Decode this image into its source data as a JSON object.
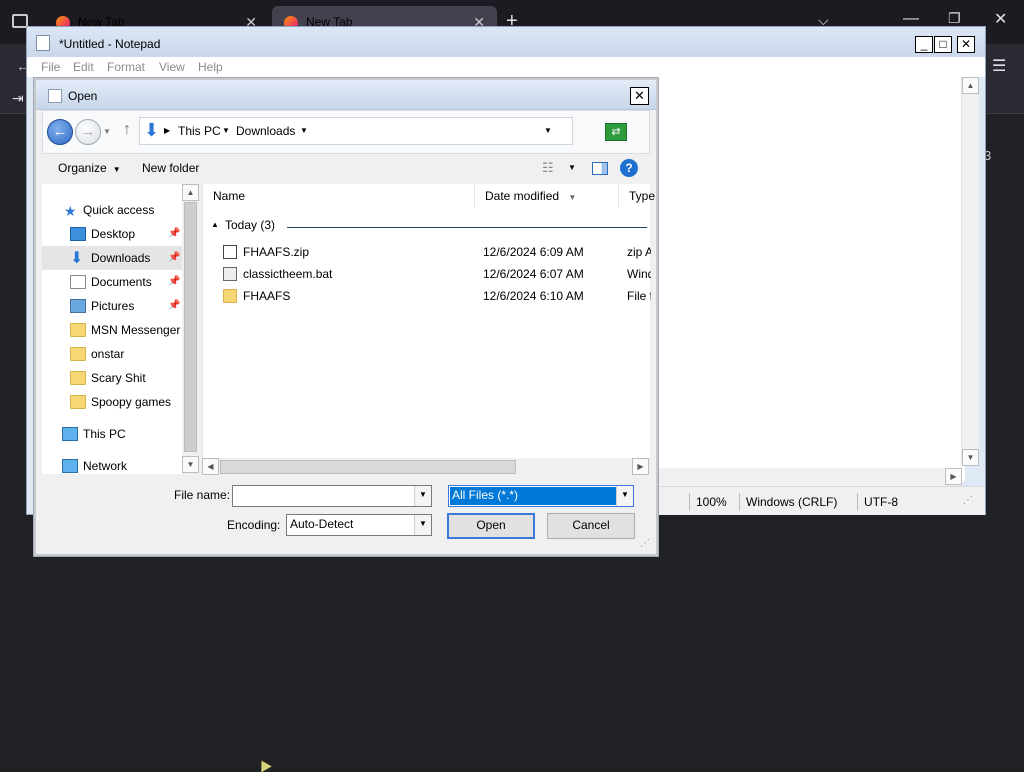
{
  "browser": {
    "tabs": [
      {
        "label": "New Tab"
      },
      {
        "label": "New Tab"
      }
    ],
    "right_partial_text": "3"
  },
  "notepad": {
    "title": "*Untitled - Notepad",
    "menu": [
      "File",
      "Edit",
      "Format",
      "View",
      "Help"
    ],
    "status": {
      "zoom": "100%",
      "line_ending": "Windows (CRLF)",
      "encoding": "UTF-8"
    }
  },
  "dialog": {
    "title": "Open",
    "breadcrumb": [
      "This PC",
      "Downloads"
    ],
    "commands": {
      "organize": "Organize",
      "new_folder": "New folder"
    },
    "nav_items": [
      {
        "label": "Quick access",
        "icon": "star-icon"
      },
      {
        "label": "Desktop",
        "icon": "desktop-icon",
        "pinned": true
      },
      {
        "label": "Downloads",
        "icon": "downloads-icon",
        "pinned": true,
        "selected": true
      },
      {
        "label": "Documents",
        "icon": "documents-icon",
        "pinned": true
      },
      {
        "label": "Pictures",
        "icon": "pictures-icon",
        "pinned": true
      },
      {
        "label": "MSN Messenger",
        "icon": "folder-icon"
      },
      {
        "label": "onstar",
        "icon": "folder-icon"
      },
      {
        "label": "Scary Shit",
        "icon": "folder-icon"
      },
      {
        "label": "Spoopy games",
        "icon": "folder-icon"
      },
      {
        "label": "This PC",
        "icon": "computer-icon"
      },
      {
        "label": "Network",
        "icon": "network-icon"
      }
    ],
    "columns": {
      "name": "Name",
      "date": "Date modified",
      "type": "Type"
    },
    "group_label": "Today (3)",
    "files": [
      {
        "name": "FHAAFS.zip",
        "date": "12/6/2024 6:09 AM",
        "type": "zip A",
        "icon": "zip-icon"
      },
      {
        "name": "classictheem.bat",
        "date": "12/6/2024 6:07 AM",
        "type": "Wind",
        "icon": "batch-file-icon"
      },
      {
        "name": "FHAAFS",
        "date": "12/6/2024 6:10 AM",
        "type": "File fo",
        "icon": "folder-icon"
      }
    ],
    "file_name_label": "File name:",
    "file_name_value": "",
    "filter_value": "All Files  (*.*)",
    "encoding_label": "Encoding:",
    "encoding_value": "Auto-Detect",
    "open_label": "Open",
    "cancel_label": "Cancel"
  },
  "colors": {
    "desktop_bg": "#202124",
    "selection_blue": "#0078d7",
    "accent_blue": "#2b78d4"
  }
}
